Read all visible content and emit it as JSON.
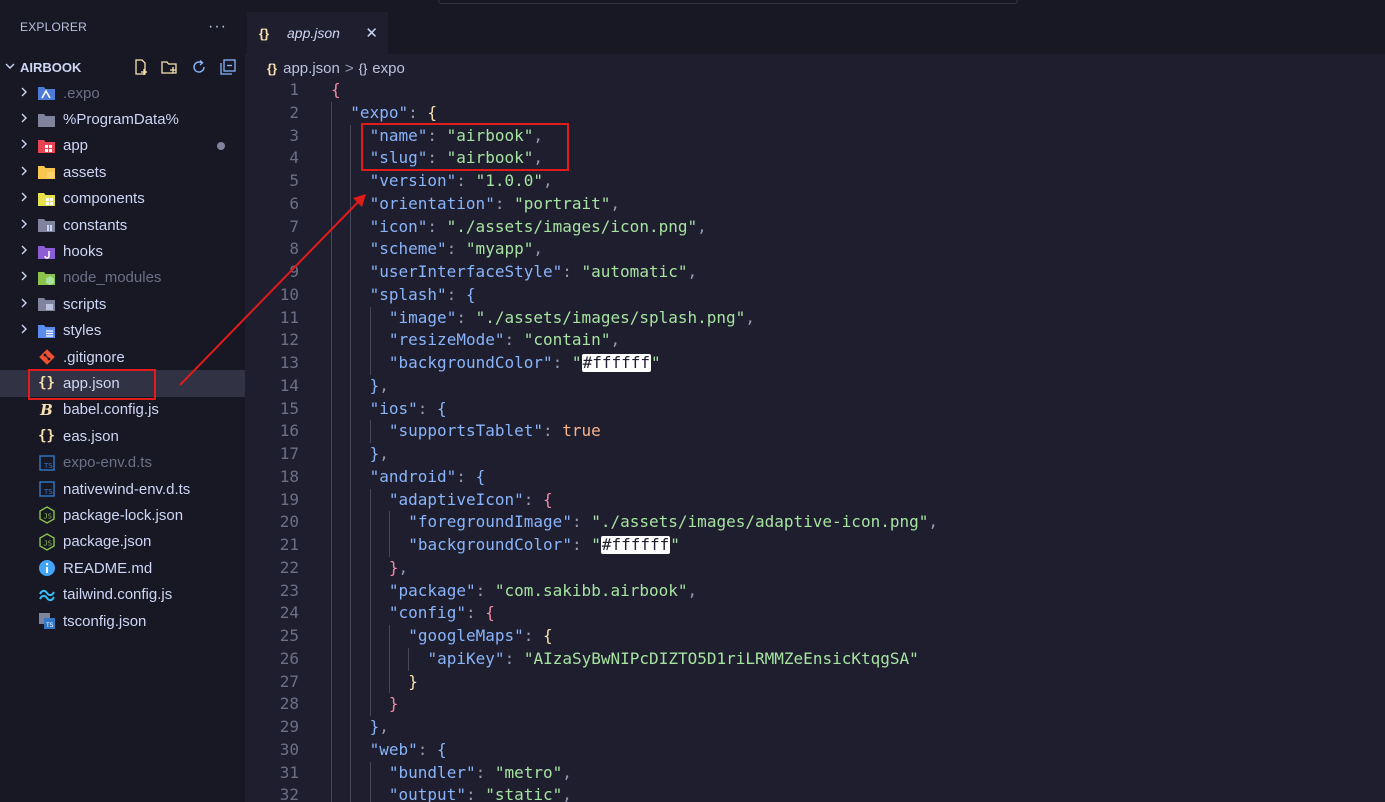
{
  "sidebar": {
    "title": "EXPLORER",
    "more": "···",
    "project": "AIRBOOK",
    "items": [
      {
        "label": ".expo",
        "type": "folder",
        "icon": "expo-folder-icon",
        "dim": true
      },
      {
        "label": "%ProgramData%",
        "type": "folder",
        "icon": "folder-icon",
        "dim": false
      },
      {
        "label": "app",
        "type": "folder",
        "icon": "app-folder-icon",
        "dim": false,
        "modified": true
      },
      {
        "label": "assets",
        "type": "folder",
        "icon": "assets-folder-icon",
        "dim": false
      },
      {
        "label": "components",
        "type": "folder",
        "icon": "components-folder-icon",
        "dim": false
      },
      {
        "label": "constants",
        "type": "folder",
        "icon": "constants-folder-icon",
        "dim": false
      },
      {
        "label": "hooks",
        "type": "folder",
        "icon": "hooks-folder-icon",
        "dim": false
      },
      {
        "label": "node_modules",
        "type": "folder",
        "icon": "node-modules-folder-icon",
        "dim": true
      },
      {
        "label": "scripts",
        "type": "folder",
        "icon": "scripts-folder-icon",
        "dim": false
      },
      {
        "label": "styles",
        "type": "folder",
        "icon": "styles-folder-icon",
        "dim": false
      },
      {
        "label": ".gitignore",
        "type": "file",
        "icon": "git-icon",
        "dim": false
      },
      {
        "label": "app.json",
        "type": "file",
        "icon": "json-icon",
        "dim": false,
        "selected": true
      },
      {
        "label": "babel.config.js",
        "type": "file",
        "icon": "babel-icon",
        "dim": false
      },
      {
        "label": "eas.json",
        "type": "file",
        "icon": "json-icon",
        "dim": false
      },
      {
        "label": "expo-env.d.ts",
        "type": "file",
        "icon": "typescript-icon",
        "dim": true
      },
      {
        "label": "nativewind-env.d.ts",
        "type": "file",
        "icon": "typescript-icon",
        "dim": false
      },
      {
        "label": "package-lock.json",
        "type": "file",
        "icon": "node-json-icon",
        "dim": false
      },
      {
        "label": "package.json",
        "type": "file",
        "icon": "node-json-icon",
        "dim": false
      },
      {
        "label": "README.md",
        "type": "file",
        "icon": "info-icon",
        "dim": false
      },
      {
        "label": "tailwind.config.js",
        "type": "file",
        "icon": "tailwind-icon",
        "dim": false
      },
      {
        "label": "tsconfig.json",
        "type": "file",
        "icon": "tsconfig-icon",
        "dim": false
      }
    ]
  },
  "editor": {
    "tab": {
      "label": "app.json",
      "icon": "{}",
      "close": "✕"
    },
    "breadcrumb": {
      "file": "app.json",
      "sep": ">",
      "symbol": "expo",
      "file_icon": "{}",
      "symbol_icon": "{}"
    },
    "lines": [
      [
        [
          "b1",
          "{"
        ]
      ],
      [
        [
          "k",
          "\"expo\""
        ],
        [
          "p",
          ": "
        ],
        [
          "b2",
          "{"
        ]
      ],
      [
        [
          "k",
          "\"name\""
        ],
        [
          "p",
          ": "
        ],
        [
          "s",
          "\"airbook\""
        ],
        [
          "p",
          ","
        ]
      ],
      [
        [
          "k",
          "\"slug\""
        ],
        [
          "p",
          ": "
        ],
        [
          "s",
          "\"airbook\""
        ],
        [
          "p",
          ","
        ]
      ],
      [
        [
          "k",
          "\"version\""
        ],
        [
          "p",
          ": "
        ],
        [
          "s",
          "\"1.0.0\""
        ],
        [
          "p",
          ","
        ]
      ],
      [
        [
          "k",
          "\"orientation\""
        ],
        [
          "p",
          ": "
        ],
        [
          "s",
          "\"portrait\""
        ],
        [
          "p",
          ","
        ]
      ],
      [
        [
          "k",
          "\"icon\""
        ],
        [
          "p",
          ": "
        ],
        [
          "s",
          "\"./assets/images/icon.png\""
        ],
        [
          "p",
          ","
        ]
      ],
      [
        [
          "k",
          "\"scheme\""
        ],
        [
          "p",
          ": "
        ],
        [
          "s",
          "\"myapp\""
        ],
        [
          "p",
          ","
        ]
      ],
      [
        [
          "k",
          "\"userInterfaceStyle\""
        ],
        [
          "p",
          ": "
        ],
        [
          "s",
          "\"automatic\""
        ],
        [
          "p",
          ","
        ]
      ],
      [
        [
          "k",
          "\"splash\""
        ],
        [
          "p",
          ": "
        ],
        [
          "b3",
          "{"
        ]
      ],
      [
        [
          "k",
          "\"image\""
        ],
        [
          "p",
          ": "
        ],
        [
          "s",
          "\"./assets/images/splash.png\""
        ],
        [
          "p",
          ","
        ]
      ],
      [
        [
          "k",
          "\"resizeMode\""
        ],
        [
          "p",
          ": "
        ],
        [
          "s",
          "\"contain\""
        ],
        [
          "p",
          ","
        ]
      ],
      [
        [
          "k",
          "\"backgroundColor\""
        ],
        [
          "p",
          ": "
        ],
        [
          "s",
          "\""
        ],
        [
          "sw",
          "#ffffff"
        ],
        [
          "s",
          "\""
        ]
      ],
      [
        [
          "b3",
          "}"
        ],
        [
          "p",
          ","
        ]
      ],
      [
        [
          "k",
          "\"ios\""
        ],
        [
          "p",
          ": "
        ],
        [
          "b3",
          "{"
        ]
      ],
      [
        [
          "k",
          "\"supportsTablet\""
        ],
        [
          "p",
          ": "
        ],
        [
          "bool",
          "true"
        ]
      ],
      [
        [
          "b3",
          "}"
        ],
        [
          "p",
          ","
        ]
      ],
      [
        [
          "k",
          "\"android\""
        ],
        [
          "p",
          ": "
        ],
        [
          "b3",
          "{"
        ]
      ],
      [
        [
          "k",
          "\"adaptiveIcon\""
        ],
        [
          "p",
          ": "
        ],
        [
          "b1",
          "{"
        ]
      ],
      [
        [
          "k",
          "\"foregroundImage\""
        ],
        [
          "p",
          ": "
        ],
        [
          "s",
          "\"./assets/images/adaptive-icon.png\""
        ],
        [
          "p",
          ","
        ]
      ],
      [
        [
          "k",
          "\"backgroundColor\""
        ],
        [
          "p",
          ": "
        ],
        [
          "s",
          "\""
        ],
        [
          "sw",
          "#ffffff"
        ],
        [
          "s",
          "\""
        ]
      ],
      [
        [
          "b1",
          "}"
        ],
        [
          "p",
          ","
        ]
      ],
      [
        [
          "k",
          "\"package\""
        ],
        [
          "p",
          ": "
        ],
        [
          "s",
          "\"com.sakibb.airbook\""
        ],
        [
          "p",
          ","
        ]
      ],
      [
        [
          "k",
          "\"config\""
        ],
        [
          "p",
          ": "
        ],
        [
          "b1",
          "{"
        ]
      ],
      [
        [
          "k",
          "\"googleMaps\""
        ],
        [
          "p",
          ": "
        ],
        [
          "b2",
          "{"
        ]
      ],
      [
        [
          "k",
          "\"apiKey\""
        ],
        [
          "p",
          ": "
        ],
        [
          "s",
          "\"AIzaSyBwNIPcDIZTO5D1riLRMMZeEnsicKtqgSA\""
        ]
      ],
      [
        [
          "b2",
          "}"
        ]
      ],
      [
        [
          "b1",
          "}"
        ]
      ],
      [
        [
          "b3",
          "}"
        ],
        [
          "p",
          ","
        ]
      ],
      [
        [
          "k",
          "\"web\""
        ],
        [
          "p",
          ": "
        ],
        [
          "b3",
          "{"
        ]
      ],
      [
        [
          "k",
          "\"bundler\""
        ],
        [
          "p",
          ": "
        ],
        [
          "s",
          "\"metro\""
        ],
        [
          "p",
          ","
        ]
      ],
      [
        [
          "k",
          "\"output\""
        ],
        [
          "p",
          ": "
        ],
        [
          "s",
          "\"static\""
        ],
        [
          "p",
          ","
        ]
      ]
    ],
    "indents": [
      0,
      1,
      2,
      2,
      2,
      2,
      2,
      2,
      2,
      2,
      3,
      3,
      3,
      2,
      2,
      3,
      2,
      2,
      3,
      4,
      4,
      3,
      3,
      3,
      4,
      5,
      4,
      3,
      2,
      2,
      3,
      3
    ]
  },
  "colors": {
    "annotation": "#e11a1a",
    "json_icon": "#f9e2af"
  }
}
